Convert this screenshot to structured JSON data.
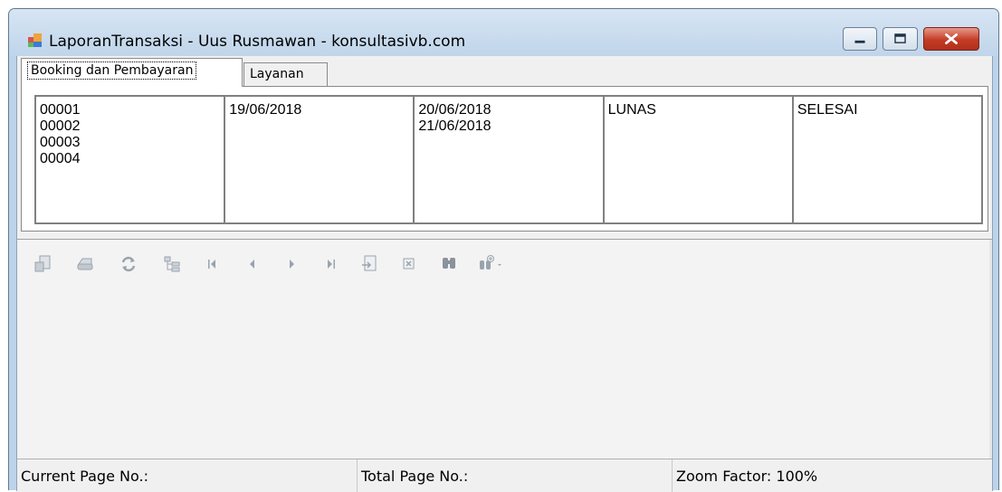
{
  "window": {
    "title": "LaporanTransaksi - Uus Rusmawan - konsultasivb.com",
    "controls": [
      "minimize-icon",
      "maximize-icon",
      "close-icon"
    ],
    "colors": {
      "frame": "#bcd3ea",
      "close": "#c43b25"
    }
  },
  "tabs": [
    {
      "label": "Booking dan Pembayaran",
      "active": true
    },
    {
      "label": "Layanan",
      "active": false
    }
  ],
  "grid": {
    "columns": [
      {
        "lines": [
          "00001",
          "00002",
          "00003",
          "00004"
        ]
      },
      {
        "lines": [
          "19/06/2018"
        ]
      },
      {
        "lines": [
          "20/06/2018",
          "21/06/2018"
        ]
      },
      {
        "lines": [
          "LUNAS"
        ]
      },
      {
        "lines": [
          "SELESAI"
        ]
      }
    ]
  },
  "toolbar": {
    "icons": [
      "export-icon",
      "print-icon",
      "refresh-icon",
      "group-tree-icon",
      "first-page-icon",
      "previous-page-icon",
      "next-page-icon",
      "last-page-icon",
      "goto-page-icon",
      "close-view-icon",
      "find-icon",
      "zoom-icon"
    ]
  },
  "status": {
    "current_page": "Current Page No.:",
    "total_page": "Total Page No.:",
    "zoom": "Zoom Factor: 100%"
  }
}
